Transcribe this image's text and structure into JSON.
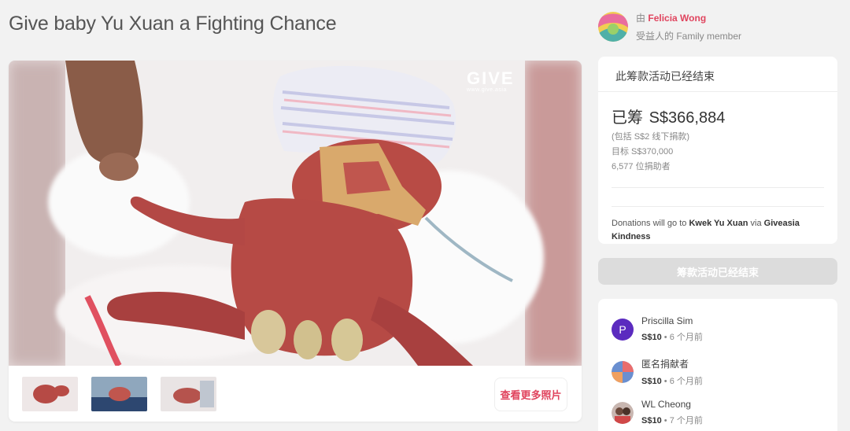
{
  "page": {
    "title": "Give baby Yu Xuan a Fighting Chance"
  },
  "photo": {
    "logo_text": "GIVE",
    "logo_url": "www.give.asia",
    "more_photos_label": "查看更多照片",
    "thumbnail_count": 3
  },
  "organizer": {
    "by_prefix": "由",
    "name": "Felicia Wong",
    "relation": "受益人的 Family member"
  },
  "campaign": {
    "status_header": "此筹款活动已经结束",
    "raised_label": "已筹",
    "raised_amount": "S$366,884",
    "offline_note": "(包括 S$2 线下捐款)",
    "goal": "目标 S$370,000",
    "donors": "6,577 位捐助者",
    "donate_prefix": "Donations will go to",
    "beneficiary": "Kwek Yu Xuan",
    "donate_via": "via",
    "platform": "Giveasia Kindness",
    "ended_button_label": "筹款活动已经结束"
  },
  "donors_list": [
    {
      "name": "Priscilla Sim",
      "amount": "S$10",
      "sep": "•",
      "time": "6 个月前",
      "avatar_letter": "P"
    },
    {
      "name": "匿名捐献者",
      "amount": "S$10",
      "sep": "•",
      "time": "6 个月前"
    },
    {
      "name": "WL Cheong",
      "amount": "S$10",
      "sep": "•",
      "time": "7 个月前"
    }
  ],
  "colors": {
    "accent": "#e0445e",
    "avatar_purple": "#5b2bbf",
    "disabled_button": "#dcdcdc",
    "background": "#f2f2f2"
  }
}
